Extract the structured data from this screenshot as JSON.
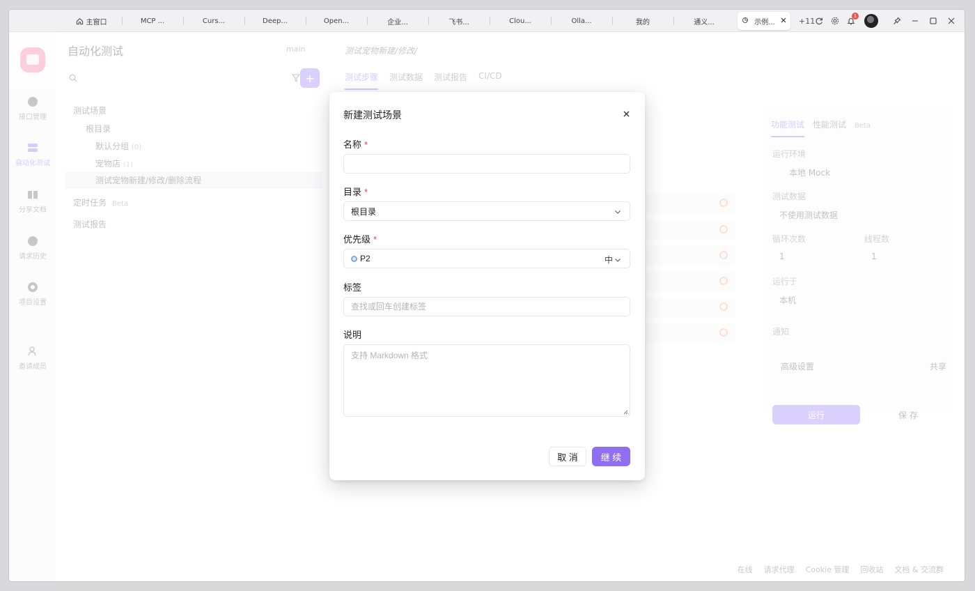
{
  "titlebar": {
    "tabs": [
      "主窗口",
      "MCP ...",
      "Curs...",
      "Deep...",
      "Open...",
      "企业...",
      "飞书...",
      "Clou...",
      "Olla...",
      "我的",
      "通义..."
    ],
    "active_tab": "示例...",
    "more_tabs": "+11",
    "notification_count": "1"
  },
  "leftbar": {
    "items": [
      "接口管理",
      "自动化测试",
      "分享文档",
      "请求历史",
      "项目设置",
      "邀请成员"
    ]
  },
  "tree": {
    "title": "自动化测试",
    "branch": "main",
    "items": {
      "scenes": "测试场景",
      "root": "根目录",
      "default_group": "默认分组",
      "default_group_count": "(0)",
      "pet_store": "宠物店",
      "pet_store_count": "(1)",
      "case": "测试宠物新建/修改/删除流程",
      "scheduled": "定时任务",
      "scheduled_badge": "Beta",
      "reports": "测试报告"
    }
  },
  "main": {
    "doc_tab_title": "测试宠物新建/修改/",
    "subtabs": [
      "测试步骤",
      "测试数据",
      "测试报告",
      "CI/CD"
    ]
  },
  "right_panel": {
    "tabs": [
      "功能测试",
      "性能测试"
    ],
    "perf_badge": "Beta",
    "env_label": "运行环境",
    "env_value": "本地 Mock",
    "data_label": "测试数据",
    "data_value": "不使用测试数据",
    "loop_label": "循环次数",
    "loop_value": "1",
    "thread_label": "线程数",
    "thread_value": "1",
    "runon_label": "运行于",
    "runon_value": "本机",
    "notify_label": "通知",
    "advanced_label": "高级设置",
    "share_label": "共享",
    "run_label": "运行",
    "save_label": "保 存"
  },
  "footer": {
    "items": [
      "在线",
      "请求代理",
      "Cookie 管理",
      "回收站",
      "文档 & 交流群"
    ]
  },
  "modal": {
    "title": "新建测试场景",
    "name_label": "名称",
    "name_value": "",
    "dir_label": "目录",
    "dir_value": "根目录",
    "priority_label": "优先级",
    "priority_value": "P2",
    "priority_level": "中",
    "tags_label": "标签",
    "tags_placeholder": "查找或回车创建标签",
    "desc_label": "说明",
    "desc_placeholder": "支持 Markdown 格式",
    "required_mark": "*",
    "cancel_label": "取 消",
    "ok_label": "继 续"
  },
  "colors": {
    "accent": "#8f6ff0",
    "required": "#e5484d",
    "priority_dot": "#7fa7d9"
  }
}
